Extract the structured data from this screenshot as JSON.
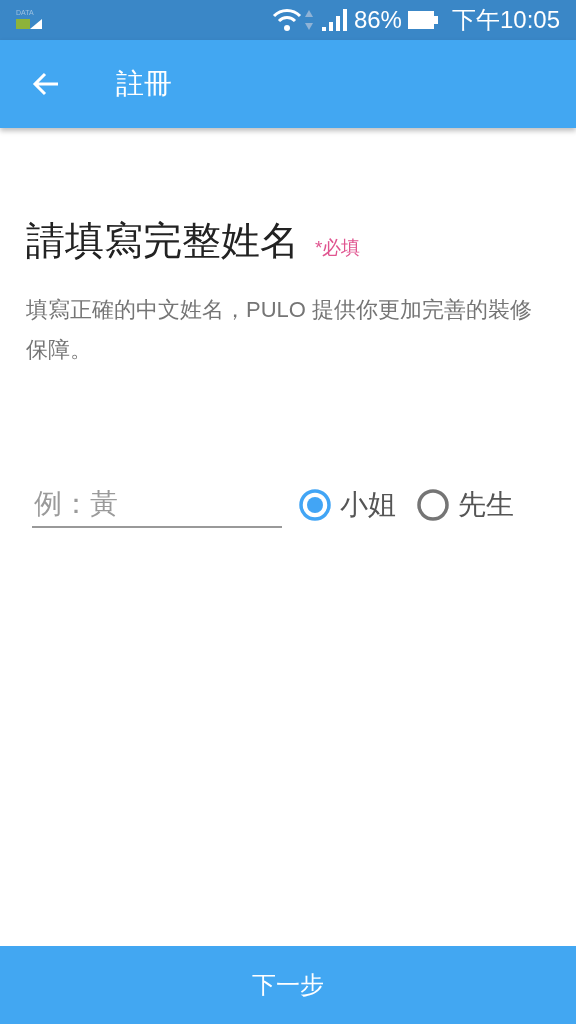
{
  "status_bar": {
    "data_label": "DATA",
    "battery_percent": "86%",
    "time": "下午10:05"
  },
  "app_bar": {
    "title": "註冊"
  },
  "heading": {
    "title": "請填寫完整姓名",
    "required_tag": "*必填"
  },
  "description": "填寫正確的中文姓名，PULO 提供你更加完善的裝修保障。",
  "name_field": {
    "placeholder": "例：黃"
  },
  "salutations": [
    {
      "label": "小姐",
      "selected": true
    },
    {
      "label": "先生",
      "selected": false
    }
  ],
  "next_button": "下一步"
}
